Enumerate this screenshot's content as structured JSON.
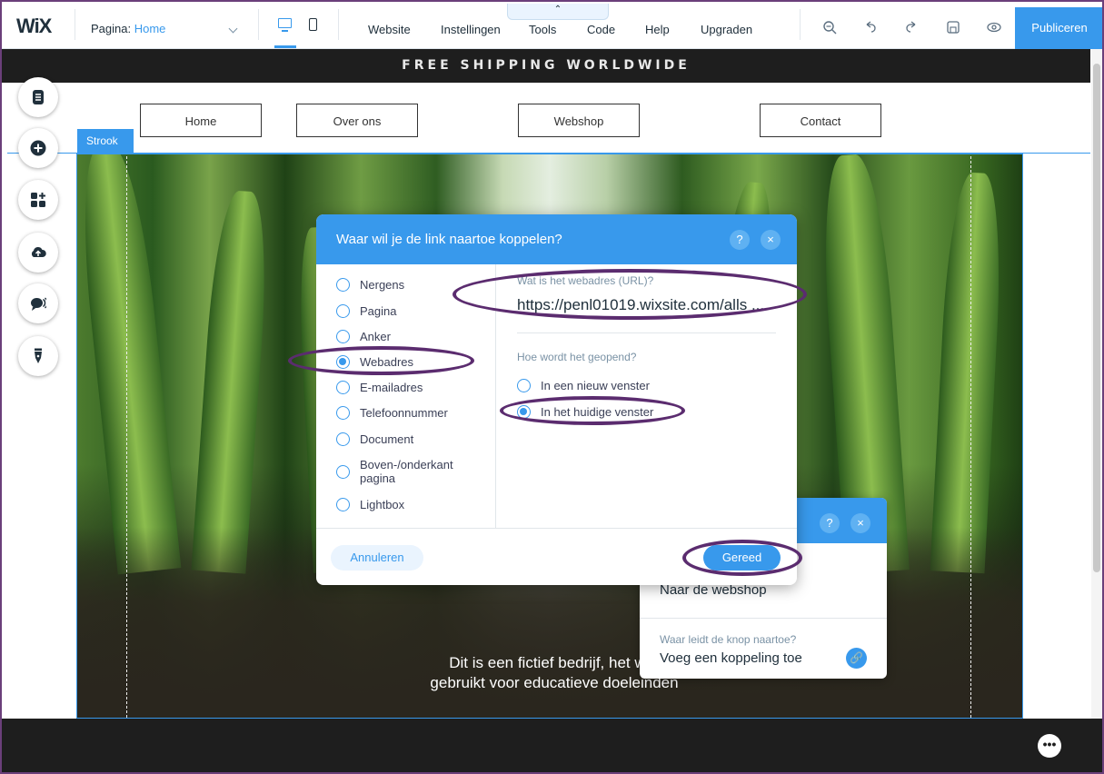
{
  "topbar": {
    "logo": "WiX",
    "page_label": "Pagina:",
    "page_value": "Home",
    "collapse_glyph": "⌃",
    "menu": [
      "Website",
      "Instellingen",
      "Tools",
      "Code",
      "Help",
      "Upgraden"
    ],
    "tools": [
      "zoom-icon",
      "undo-icon",
      "redo-icon",
      "save-icon",
      "preview-icon"
    ],
    "publish": "Publiceren"
  },
  "site": {
    "banner": "FREE SHIPPING WORLDWIDE",
    "nav": [
      "Home",
      "Over ons",
      "Webshop",
      "Contact"
    ],
    "strip_label": "Strook",
    "hero_text_1": "Dit is een fictief bedrijf, het wor",
    "hero_text_2": "gebruikt voor educatieve doeleinden"
  },
  "sidebar": [
    "pages-icon",
    "add-icon",
    "apps-icon",
    "upload-icon",
    "chat-icon",
    "pen-icon"
  ],
  "dialog": {
    "title": "Waar wil je de link naartoe koppelen?",
    "help": "?",
    "close": "×",
    "options": [
      "Nergens",
      "Pagina",
      "Anker",
      "Webadres",
      "E-mailadres",
      "Telefoonnummer",
      "Document",
      "Boven-/onderkant pagina",
      "Lightbox"
    ],
    "selected_option": "Webadres",
    "url_label": "Wat is het webadres (URL)?",
    "url_value": "https://penl01019.wixsite.com/alls  ...",
    "open_label": "Hoe wordt het geopend?",
    "open_options": [
      "In een nieuw venster",
      "In het huidige venster"
    ],
    "open_selected": "In het huidige venster",
    "cancel": "Annuleren",
    "done": "Gereed"
  },
  "panel": {
    "help": "?",
    "close": "×",
    "button_text": "Naar de webshop",
    "link_label": "Waar leidt de knop naartoe?",
    "link_value": "Voeg een koppeling toe",
    "link_icon": "🔗"
  },
  "colors": {
    "accent": "#3899ec",
    "annotation": "#5b2c6f",
    "dark": "#1e1e1e"
  }
}
